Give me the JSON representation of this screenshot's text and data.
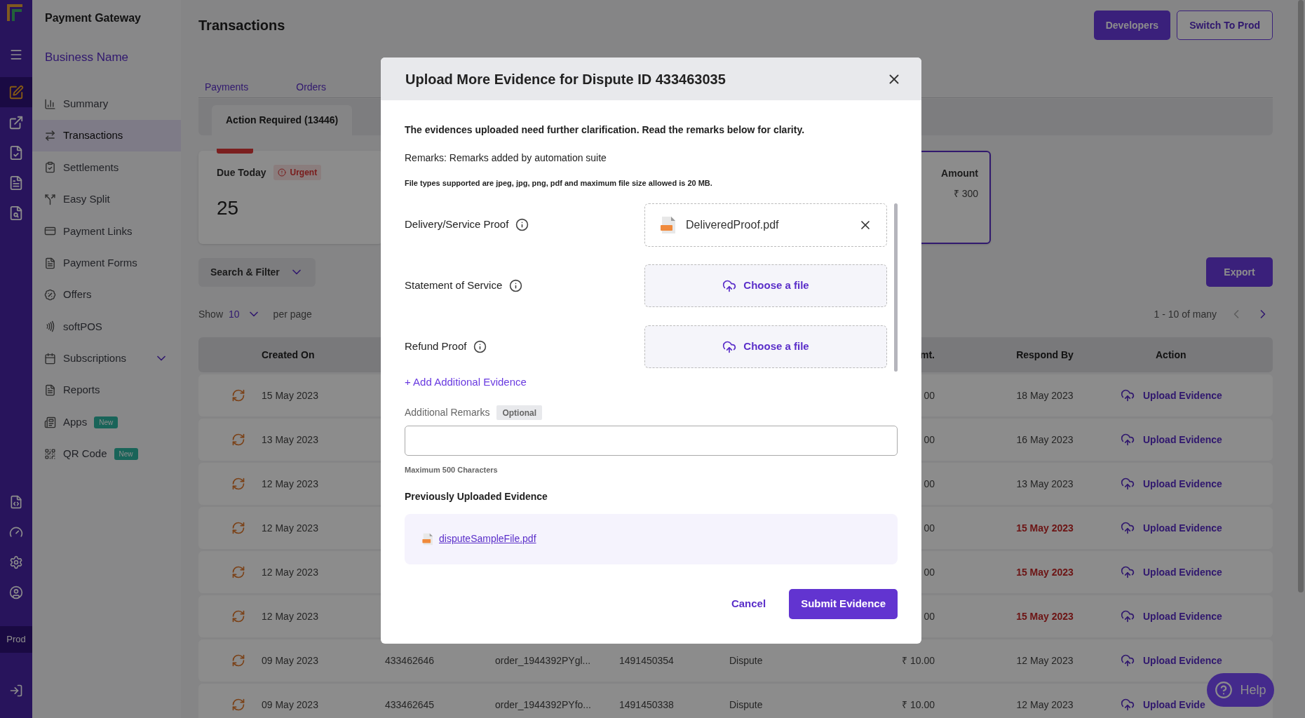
{
  "rail": {
    "top_items": [
      {
        "selected": true
      },
      {
        "selected": false
      },
      {
        "selected": false
      },
      {
        "selected": false
      },
      {
        "selected": false
      }
    ],
    "env": "Prod"
  },
  "sidebar": {
    "app_title": "Payment Gateway",
    "business": "Business Name",
    "items": [
      {
        "kind": "summary",
        "label": "Summary",
        "selected": false
      },
      {
        "kind": "transactions",
        "label": "Transactions",
        "selected": true
      },
      {
        "kind": "settlements",
        "label": "Settlements",
        "selected": false
      },
      {
        "kind": "split",
        "label": "Easy Split",
        "selected": false
      },
      {
        "kind": "links",
        "label": "Payment Links",
        "selected": false
      },
      {
        "kind": "forms",
        "label": "Payment Forms",
        "selected": false
      },
      {
        "kind": "offers",
        "label": "Offers",
        "selected": false
      },
      {
        "kind": "pos",
        "label": "softPOS",
        "selected": false
      },
      {
        "kind": "subscriptions",
        "label": "Subscriptions",
        "selected": false,
        "expanded": false
      },
      {
        "kind": "reports",
        "label": "Reports",
        "selected": false
      },
      {
        "kind": "apps",
        "label": "Apps",
        "selected": false,
        "badge": "New"
      },
      {
        "kind": "qr",
        "label": "QR Code",
        "selected": false,
        "badge": "New"
      }
    ]
  },
  "header": {
    "title": "Transactions",
    "buttons": [
      {
        "label": "Developers",
        "kind": "primary"
      },
      {
        "label": "Switch To Prod",
        "kind": "outline"
      }
    ]
  },
  "tabs": [
    {
      "label": "Payments",
      "selected": false
    },
    {
      "label": "Orders",
      "selected": false
    }
  ],
  "subtabs": [
    {
      "label": "Action Required (13446)",
      "selected": true
    }
  ],
  "cards": [
    {
      "title": "Due Today",
      "badge": "Urgent",
      "value": "25",
      "highlighted": false
    },
    {
      "title": "Amount",
      "value": "₹ 300",
      "highlighted": true
    }
  ],
  "filter": {
    "label": "Search & Filter"
  },
  "export": "Export",
  "pagination": {
    "show": "Show",
    "per_page_value": "10",
    "per_page": "per page",
    "range": "1 - 10 of many",
    "prev_disabled": true
  },
  "table": {
    "columns": {
      "created_on": "Created On",
      "amount": "mt.",
      "respond_by": "Respond By",
      "action": "Action"
    },
    "rows": [
      {
        "created_on": "15 May 2023",
        "amount": "00",
        "respond_by": "18 May 2023",
        "overdue": false,
        "action": "Upload Evidence"
      },
      {
        "created_on": "13 May 2023",
        "amount": "00",
        "respond_by": "16 May 2023",
        "overdue": false,
        "action": "Upload Evidence"
      },
      {
        "created_on": "12 May 2023",
        "amount": "00",
        "respond_by": "13 May 2023",
        "overdue": false,
        "action": "Upload Evidence"
      },
      {
        "created_on": "12 May 2023",
        "amount": "00",
        "respond_by": "15 May 2023",
        "overdue": true,
        "action": "Upload Evidence"
      },
      {
        "created_on": "12 May 2023",
        "amount": "00",
        "respond_by": "15 May 2023",
        "overdue": true,
        "action": "Upload Evidence"
      },
      {
        "created_on": "12 May 2023",
        "amount": "00",
        "respond_by": "15 May 2023",
        "overdue": true,
        "action": "Upload Evidence"
      },
      {
        "created_on": "09 May 2023",
        "column_2": "433462646",
        "column_3": "order_1944392PYgl...",
        "column_4": "1491450354",
        "column_5": "Dispute",
        "amount": "₹ 10.00",
        "respond_by": "12 May 2023",
        "overdue": false,
        "action": "Upload Evidence"
      },
      {
        "created_on": "09 May 2023",
        "column_2": "433462645",
        "column_3": "order_1944392PYfo...",
        "column_4": "1491450338",
        "column_5": "Dispute",
        "amount": "₹ 10.00",
        "respond_by": "12 May 2023",
        "overdue": false,
        "action": "Upload Evide"
      }
    ]
  },
  "modal": {
    "title": "Upload More Evidence for Dispute ID 433463035",
    "intro": "The evidences uploaded need further clarification. Read the remarks below for clarity.",
    "remarks": "Remarks: Remarks added by automation suite",
    "file_note": "File types supported are jpeg, jpg, png, pdf and maximum file size allowed is 20 MB.",
    "evidence": [
      {
        "kind": "uploaded",
        "label": "Delivery/Service Proof",
        "file": "DeliveredProof.pdf"
      },
      {
        "kind": "empty",
        "label": "Statement of Service",
        "button": "Choose a file"
      },
      {
        "kind": "empty",
        "label": "Refund Proof",
        "button": "Choose a file"
      }
    ],
    "add_link": "+ Add Additional Evidence",
    "remarks_label": "Additional Remarks",
    "optional": "Optional",
    "remarks_hint": "Maximum 500 Characters",
    "previous_title": "Previously Uploaded Evidence",
    "previous_files": [
      "disputeSampleFile.pdf"
    ],
    "cancel": "Cancel",
    "submit": "Submit Evidence"
  },
  "help": "Help"
}
